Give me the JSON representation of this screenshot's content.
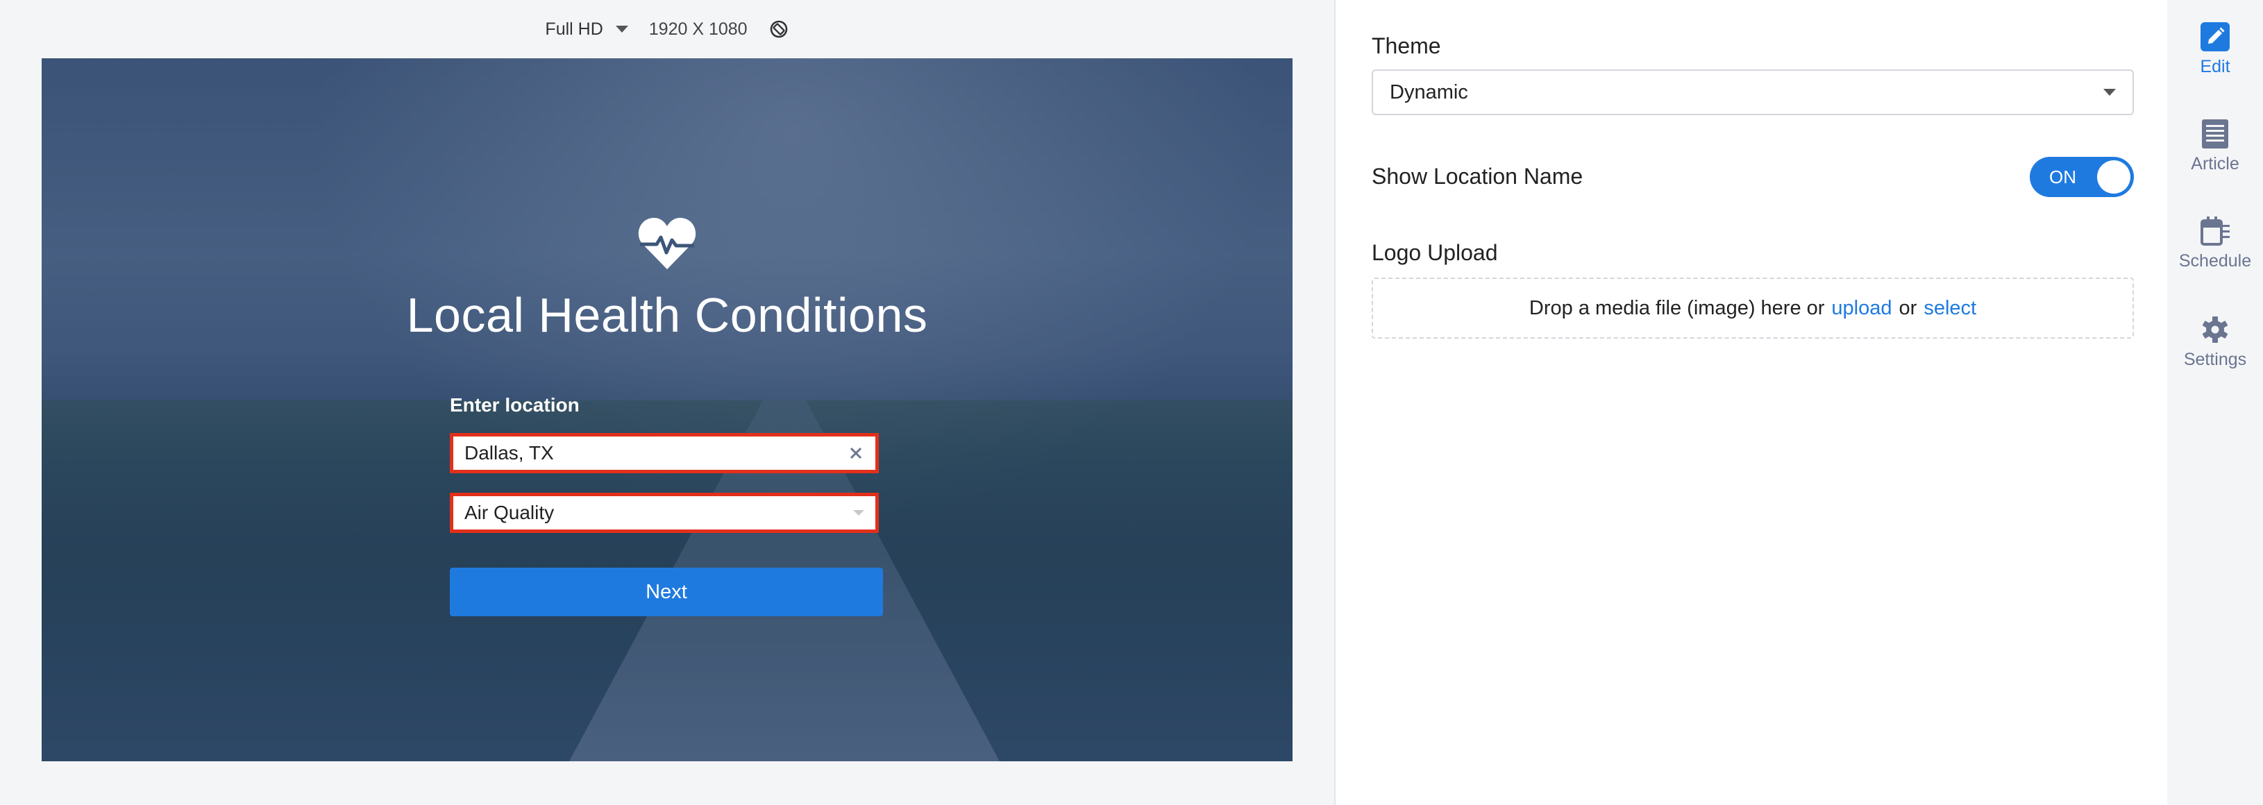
{
  "toolbar": {
    "resolution": "Full HD",
    "dimensions": "1920 X 1080"
  },
  "preview": {
    "title": "Local Health Conditions",
    "location_label": "Enter location",
    "location_value": "Dallas, TX",
    "category_value": "Air Quality",
    "next_label": "Next"
  },
  "settings": {
    "theme_label": "Theme",
    "theme_value": "Dynamic",
    "show_location_label": "Show Location Name",
    "toggle_label": "ON",
    "toggle_on": true,
    "logo_label": "Logo Upload",
    "drop_text_before": "Drop a media file (image) here or",
    "drop_link_upload": "upload",
    "drop_text_or": "or",
    "drop_link_select": "select"
  },
  "rail": {
    "items": [
      {
        "label": "Edit",
        "icon": "pencil-icon",
        "active": true
      },
      {
        "label": "Article",
        "icon": "article-icon",
        "active": false
      },
      {
        "label": "Schedule",
        "icon": "schedule-icon",
        "active": false
      },
      {
        "label": "Settings",
        "icon": "gear-icon",
        "active": false
      }
    ]
  },
  "colors": {
    "accent": "#1f7ae0",
    "highlight_border": "#e2301b",
    "rail_text": "#6a7590"
  }
}
